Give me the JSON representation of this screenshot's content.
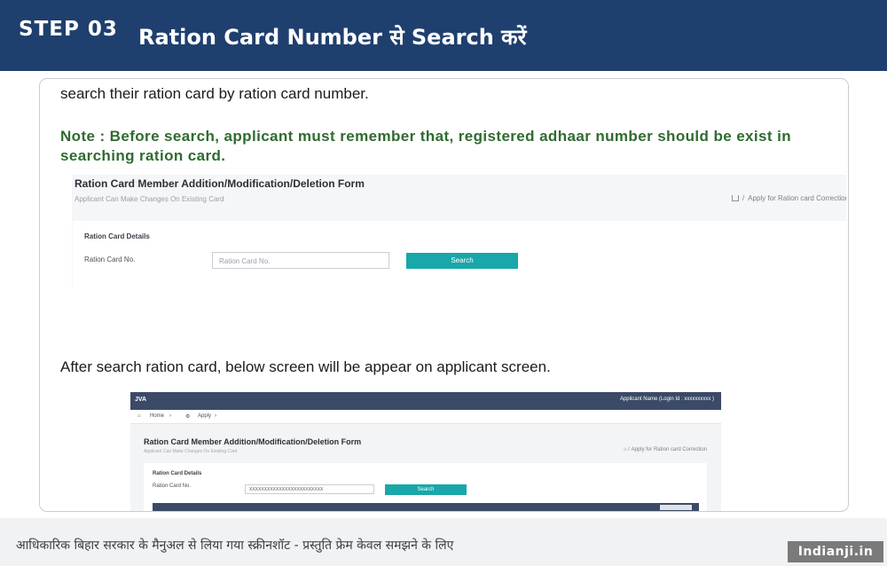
{
  "header": {
    "step": "STEP 03",
    "title": "Ration Card Number से Search करें",
    "background_color": "#1f3f6e"
  },
  "content": {
    "intro_text": "search their ration card by ration card number.",
    "note_line_1": "Note : Before search, applicant must remember that, registered adhaar number should be exist in",
    "note_line_2": "searching ration card.",
    "after_search_text": "After search ration card, below screen will be appear on applicant screen.",
    "note_color": "#2f6b2f"
  },
  "screenshot_1": {
    "title": "Ration Card Member Addition/Modification/Deletion Form",
    "subtitle": "Applicant Can Make Changes On Existing Card",
    "breadcrumb": "Apply for Ration card Correction",
    "panel_title": "Ration Card Details",
    "field_label": "Ration Card No.",
    "input_placeholder": "Ration Card No.",
    "search_button": "Search",
    "button_color": "#19a7a9"
  },
  "screenshot_2": {
    "app_logo": "JVA",
    "user_label": "Applicant Name  (Login Id : xxxxxxxxxx  )",
    "nav_home": "Home",
    "nav_apply": "Apply",
    "title": "Ration Card Member Addition/Modification/Deletion Form",
    "subtitle": "Applicant Can Make Changes On Existing Card",
    "breadcrumb": "Apply for Ration card Correction",
    "panel_title": "Ration Card Details",
    "field_label": "Ration Card No.",
    "input_value": "XXXXXXXXXXXXXXXXXXXXXXXXX",
    "search_button": "Search"
  },
  "footer": {
    "caption": "आधिकारिक बिहार सरकार के मैनुअल से लिया गया स्क्रीनशॉट - प्रस्तुति फ्रेम केवल समझने के लिए",
    "brand": "Indianji.in"
  }
}
